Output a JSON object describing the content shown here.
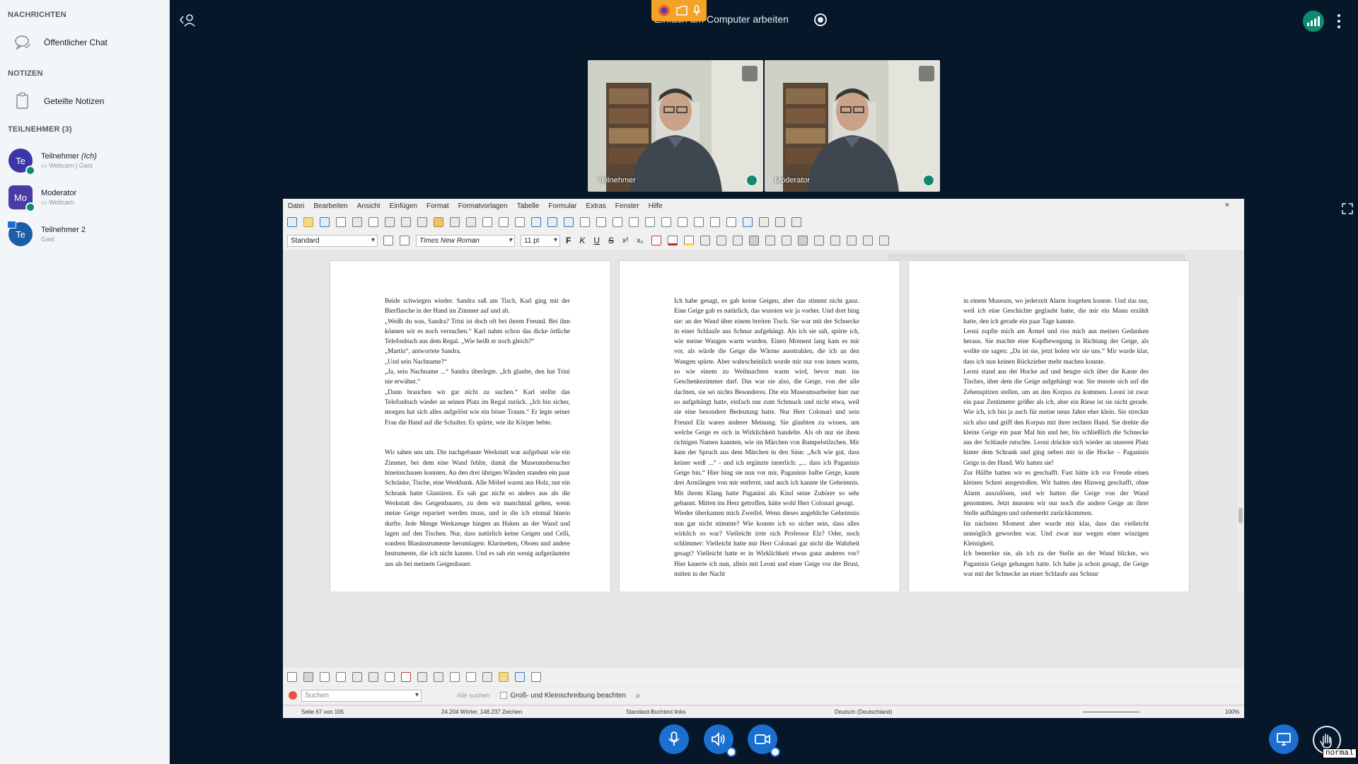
{
  "sidebar": {
    "messages_header": "NACHRICHTEN",
    "public_chat": "Öffentlicher Chat",
    "notes_header": "NOTIZEN",
    "shared_notes": "Geteilte Notizen",
    "participants_header": "TEILNEHMER (3)",
    "users": [
      {
        "initials": "Te",
        "name": "Teilnehmer",
        "self_tag": "(Ich)",
        "sub": "Webcam | Gast",
        "color": "#3a35a8"
      },
      {
        "initials": "Mo",
        "name": "Moderator",
        "sub": "Webcam",
        "color": "#4a3aa6"
      },
      {
        "initials": "Te",
        "name": "Teilnehmer 2",
        "sub": "Gast",
        "color": "#1a5ea8"
      }
    ]
  },
  "topbar": {
    "title": "Einfach am Computer arbeiten",
    "status_color": "#0f8a6e"
  },
  "cams": [
    {
      "label": "Teilnehmer"
    },
    {
      "label": "Moderator"
    }
  ],
  "writer": {
    "menu": [
      "Datei",
      "Bearbeiten",
      "Ansicht",
      "Einfügen",
      "Format",
      "Formatvorlagen",
      "Tabelle",
      "Formular",
      "Extras",
      "Fenster",
      "Hilfe"
    ],
    "close": "×",
    "para_style": "Standard",
    "font_name": "Times New Roman",
    "font_size": "11 pt",
    "fmt_bold": "F",
    "fmt_italic": "K",
    "fmt_underline": "U",
    "fmt_strike": "S",
    "fmt_sup": "x²",
    "fmt_sub": "x₂",
    "pages": [
      "Beide schwiegen wieder. Sandra saß am Tisch, Karl ging mit der Bierflasche in der Hand im Zimmer auf und ab.\n„Weißt du was, Sandra? Trini ist doch oft bei ihrem Freund. Bei ihm können wir es noch versuchen.“ Karl nahm schon das dicke örtliche Telefonbuch aus dem Regal. „Wie heißt er noch gleich?“\n„Martin“, antwortete Sandra.\n„Und sein Nachname?“\n„Ja, sein Nachname ...“ Sandra überlegte. „Ich glaube, den hat Trini nie erwähnt.“\n„Dann brauchen wir gar nicht zu suchen.“ Karl stellte das Telefonbuch wieder an seinen Platz im Regal zurück. „Ich bin sicher, morgen hat sich alles aufgelöst wie ein böser Traum.“ Er legte seiner Frau die Hand auf die Schulter. Er spürte, wie ihr Körper bebte.\n\n\n   Wir sahen uns um. Die nachgebaute Werkstatt war aufgebaut wie ein Zimmer, bei dem eine Wand fehlte, damit die Museumsbesucher hineinschauen konnten. An den drei übrigen Wänden standen ein paar Schränke, Tische, eine Werkbank. Alle Möbel waren aus Holz, nur ein Schrank hatte Glastüren. Es sah gar nicht so anders aus als die Werkstatt des Geigenbauers, zu dem wir manchmal gehen, wenn meine Geige repariert werden muss, und in die ich einmal hinein durfte. Jede Menge Werkzeuge hingen an Haken an der Wand und lagen auf den Tischen. Nur, dass natürlich keine Geigen und Celli, sondern Blasinstrumente herumlagen: Klarinetten, Oboen und andere Instrumente, die ich nicht kannte. Und es sah ein wenig aufgeräumter aus als bei meinem Geigenbauer.",
      "   Ich habe gesagt, es gab keine Geigen, aber das stimmt nicht ganz. Eine Geige gab es natürlich, das wussten wir ja vorher. Und dort hing sie: an der Wand über einem breiten Tisch. Sie war mit der Schnecke in einer Schlaufe aus Schnur aufgehängt. Als ich sie sah, spürte ich, wie meine Wangen warm wurden. Einen Moment lang kam es mir vor, als würde die Geige die Wärme ausstrahlen, die ich an den Wangen spürte. Aber wahrscheinlich wurde mir nur von innen warm, so wie einem zu Weihnachten warm wird, bevor man ins Geschenkezimmer darf. Das war sie also, die Geige, von der alle dachten, sie sei nichts Besonderes. Die ein Museumsarbeiter hier nur so aufgehängt hatte, einfach nur zum Schmuck und nicht etwa, weil sie eine besondere Bedeutung hatte. Nur Herr Colonari und sein Freund Elz waren anderer Meinung. Sie glaubten zu wissen, um welche Geige es sich in Wirklichkeit handelte. Als ob nur sie ihren richtigen Namen kannten, wie im Märchen von Rumpelstilzchen. Mir kam der Spruch aus dem Märchen in den Sinn: „Ach wie gut, dass keiner weiß ...“ - und ich ergänzte innerlich: „... dass ich Paganinis Geige bin.“ Hier hing sie nun vor mir, Paganinis halbe Geige, kaum drei Armlängen von mir entfernt, und auch ich kannte ihr Geheimnis. Mit ihrem Klang hatte Paganini als Kind seine Zuhörer so sehr gebannt. Mitten ins Herz getroffen, hätte wohl Herr Colonari gesagt.\n   Wieder überkamen mich Zweifel. Wenn dieses angebliche Geheimnis nun gar nicht stimmte? Wie konnte ich so sicher sein, dass alles wirklich so war? Vielleicht irrte sich Professor Elz? Oder, noch schlimmer: Vielleicht hatte mir Herr Colonari gar nicht die Wahrheit gesagt? Vielleicht hatte er in Wirklichkeit etwas ganz anderes vor? Hier kauerte ich nun, allein mit Leoni und einer Geige vor der Brust, mitten in der Nacht",
      "in einem Museum, wo jederzeit Alarm losgehen konnte. Und das nur, weil ich eine Geschichte geglaubt hatte, die mir ein Mann erzählt hatte, den ich gerade ein paar Tage kannte.\n   Leoni zupfte mich am Ärmel und riss mich aus meinen Gedanken heraus. Sie machte eine Kopfbewegung in Richtung der Geige, als wollte sie sagen: „Da ist sie, jetzt holen wir sie uns.“ Mir wurde klar, dass ich nun keinen Rückzieher mehr machen konnte.\n   Leoni stand aus der Hocke auf und beugte sich über die Kante des Tisches, über dem die Geige aufgehängt war. Sie musste sich auf die Zehenspitzen stellen, um an den Korpus zu kommen. Leoni ist zwar ein paar Zentimeter größer als ich, aber ein Riese ist sie nicht gerade. Wie ich, ich bin ja auch für meine neun Jahre eher klein. Sie streckte sich also und griff den Korpus mit ihrer rechten Hand. Sie drehte die kleine Geige ein paar Mal hin und her, bis schließlich die Schnecke aus der Schlaufe rutschte. Leoni drückte sich wieder an unseren Platz hinter dem Schrank und ging neben mir in die Hocke – Paganinis Geige in der Hand. Wir hatten sie!\n   Zur Hälfte hatten wir es geschafft. Fast hätte ich vor Freude einen kleinen Schrei ausgestoßen. Wir hatten den Hinweg geschafft, ohne Alarm auszulösen, und wir hatten die Geige von der Wand genommen. Jetzt mussten wir nur noch die andere Geige an ihrer Stelle aufhängen und unbemerkt zurückkommen.\n   Im nächsten Moment aber wurde mir klar, dass das vielleicht unmöglich geworden war. Und zwar nur wegen einer winzigen Kleinigkeit.\n   Ich bemerkte sie, als ich zu der Stelle an der Wand blickte, wo Paganinis Geige gehangen hatte. Ich habe ja schon gesagt, die Geige war mit der Schnecke an einer Schlaufe aus Schnur"
    ],
    "find_placeholder": "Suchen",
    "find_button": "Alle suchen",
    "match_case": "Groß- und Kleinschreibung beachten",
    "status": {
      "page": "Seite 67 von 105",
      "words": "24.204 Wörter, 148.237 Zeichen",
      "page_style": "Standard-Buchtext links",
      "language": "Deutsch (Deutschland)",
      "zoom": "100%"
    }
  },
  "tooltip": "normal"
}
